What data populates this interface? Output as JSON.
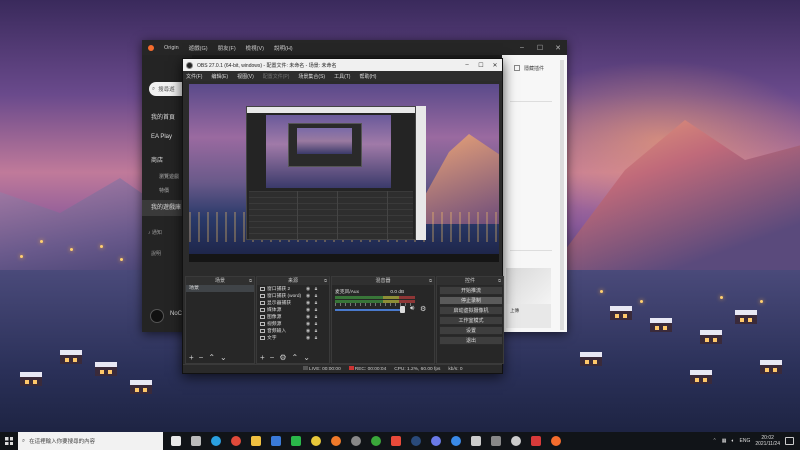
{
  "origin": {
    "title": "Origin",
    "menu": [
      "遊戲(G)",
      "朋友(F)",
      "檢視(V)",
      "說明(H)"
    ],
    "search_placeholder": "搜尋遊",
    "nav": [
      {
        "label": "我的首頁"
      },
      {
        "label": "EA Play"
      },
      {
        "label": "商店"
      },
      {
        "label": "瀏覽遊戲",
        "sub": true
      },
      {
        "label": "特價",
        "sub": true
      },
      {
        "label": "我的遊戲庫",
        "active": true
      }
    ],
    "notifications_label": "通知",
    "help_label": "說明",
    "username": "NoC",
    "right_panel_label": "隱藏插件",
    "card_text": "上傳"
  },
  "obs": {
    "title": "OBS 27.0.1 (64-bit, windows) - 配置文件: 未命名 - 场景: 未命名",
    "menu": [
      "文件(F)",
      "编辑(E)",
      "视图(V)",
      "配置文件(P)",
      "场景集合(S)",
      "工具(T)",
      "帮助(H)"
    ],
    "docks": {
      "scenes": {
        "title": "场景",
        "items": [
          "场景"
        ]
      },
      "sources": {
        "title": "来源",
        "items": [
          "窗口捕获 2",
          "窗口捕获 (word)",
          "显示器捕获",
          "媒体源",
          "图像源",
          "视频源",
          "音频输入",
          "文字"
        ]
      },
      "mixer": {
        "title": "混音器",
        "channel": "麦克风/Aux",
        "db": "0.0 dB"
      },
      "controls": {
        "title": "控件",
        "buttons": [
          "开始推流",
          "停止录制",
          "启动虚拟摄像机",
          "工作室模式",
          "设置",
          "退出"
        ]
      }
    },
    "status": {
      "live_label": "LIVE:",
      "live_time": "00:00:00",
      "rec_label": "REC:",
      "rec_time": "00:00:04",
      "cpu": "CPU: 1.2%, 60.00 fps",
      "kbps": "kb/s: 0"
    },
    "nested_status": "REC 00:00:04"
  },
  "taskbar": {
    "search_placeholder": "在這裡輸入你要搜尋的內容",
    "apps": [
      {
        "icon": "obs-studio-icon",
        "color": "#e8e8e8"
      },
      {
        "icon": "task-view-icon",
        "color": "#bbbbbb"
      },
      {
        "icon": "edge-icon",
        "color": "#2aa0e0"
      },
      {
        "icon": "chrome-icon",
        "color": "#e04a3a"
      },
      {
        "icon": "folder-icon",
        "color": "#f0c040"
      },
      {
        "icon": "mail-icon",
        "color": "#3a7ad8"
      },
      {
        "icon": "wechat-icon",
        "color": "#2ab84a"
      },
      {
        "icon": "chrome-alt-icon",
        "color": "#e8c83a"
      },
      {
        "icon": "firefox-icon",
        "color": "#f07a2a"
      },
      {
        "icon": "steam-alt-icon",
        "color": "#888888"
      },
      {
        "icon": "xbox-icon",
        "color": "#3aa83a"
      },
      {
        "icon": "ea-icon",
        "color": "#e84a3a"
      },
      {
        "icon": "steam-icon",
        "color": "#2a4a7a"
      },
      {
        "icon": "discord-icon",
        "color": "#6a7ae8"
      },
      {
        "icon": "uplay-icon",
        "color": "#3a8ae8"
      },
      {
        "icon": "epic-icon",
        "color": "#cccccc"
      },
      {
        "icon": "game-icon",
        "color": "#888888"
      },
      {
        "icon": "speedometer-icon",
        "color": "#cccccc"
      },
      {
        "icon": "red-app-icon",
        "color": "#d83a3a"
      },
      {
        "icon": "origin-icon",
        "color": "#f56c2d"
      }
    ],
    "lang": "ENG",
    "time": "20:02",
    "date": "2021/11/24"
  }
}
